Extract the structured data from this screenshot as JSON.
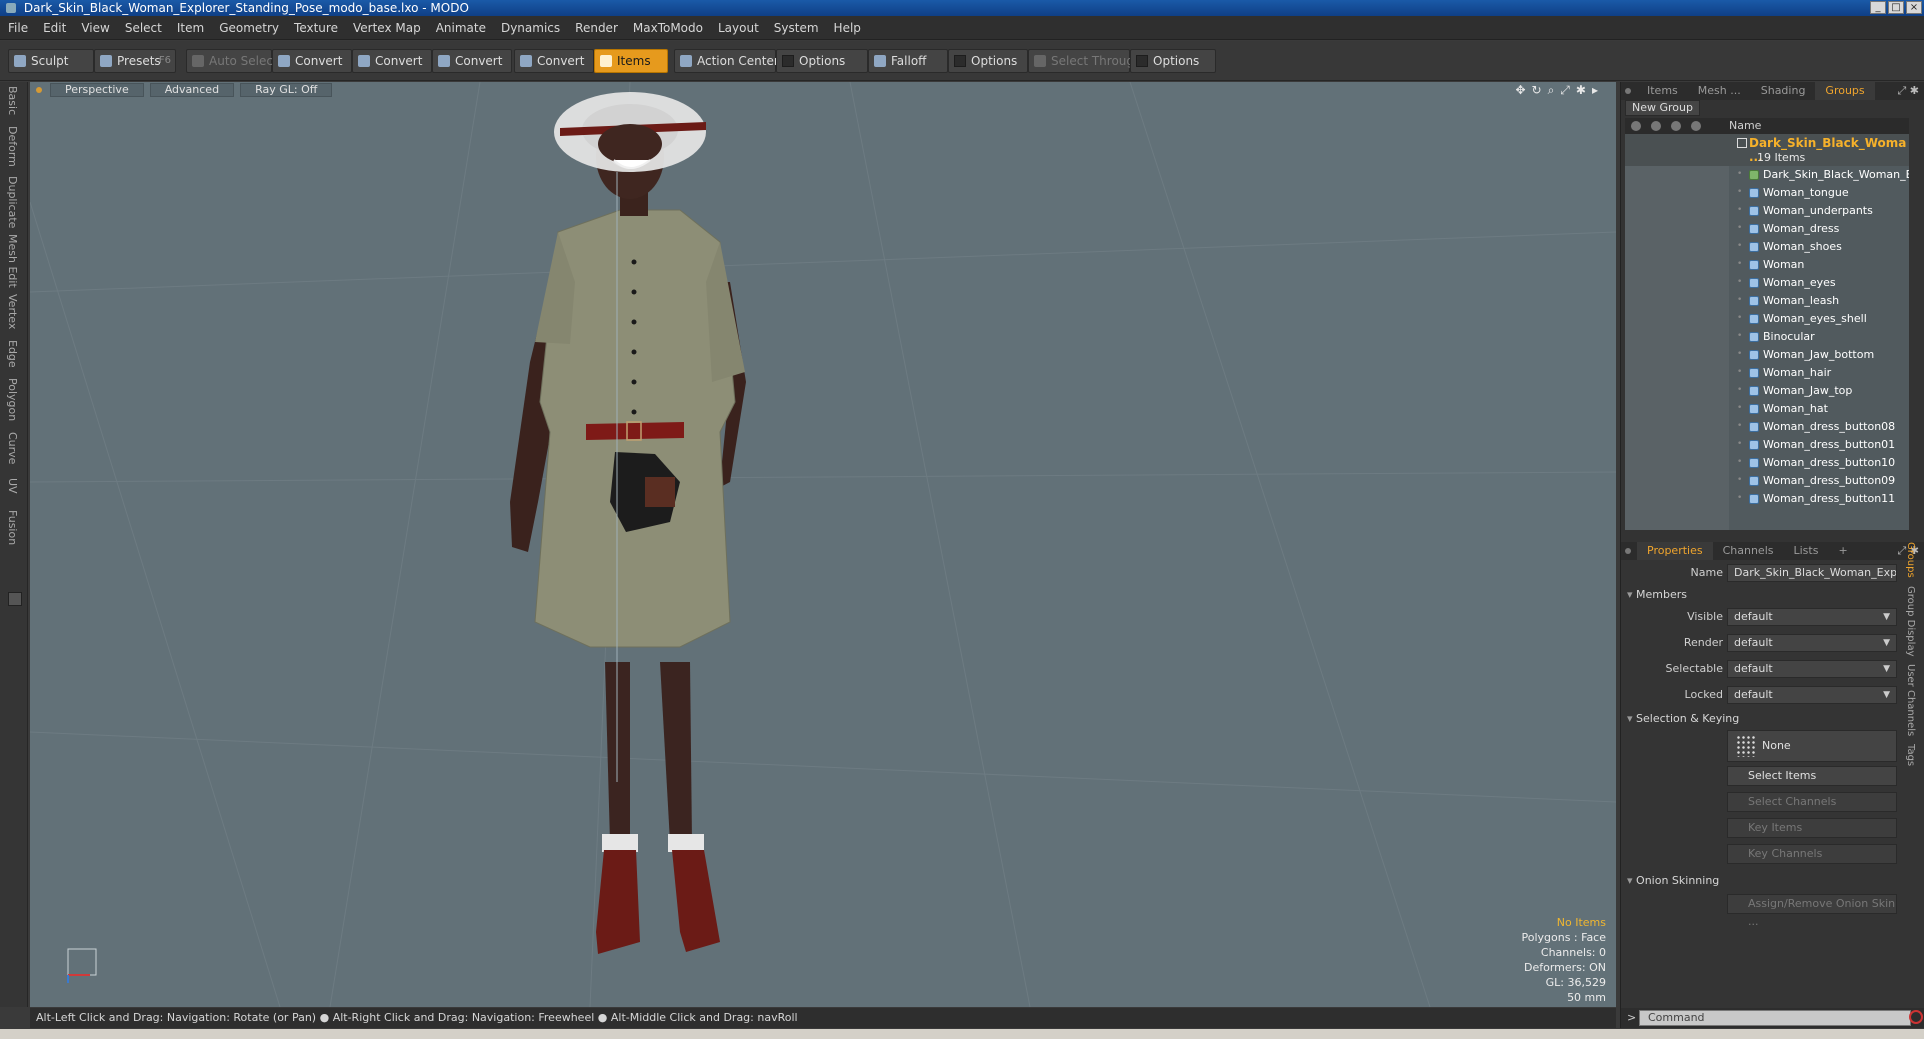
{
  "window": {
    "title": "Dark_Skin_Black_Woman_Explorer_Standing_Pose_modo_base.lxo - MODO",
    "controls": [
      "_",
      "□",
      "×"
    ]
  },
  "menu": [
    "File",
    "Edit",
    "View",
    "Select",
    "Item",
    "Geometry",
    "Texture",
    "Vertex Map",
    "Animate",
    "Dynamics",
    "Render",
    "MaxToModo",
    "Layout",
    "System",
    "Help"
  ],
  "toolbar": {
    "sculpt": "Sculpt",
    "presets": "Presets",
    "presets_hotkey": "F6",
    "auto_select": "Auto Select",
    "convert": "Convert",
    "items": "Items",
    "action_center": "Action Center",
    "options": "Options",
    "falloff": "Falloff",
    "select_through": "Select Through"
  },
  "left_tabs": [
    "Basic",
    "Deform",
    "Duplicate",
    "Mesh Edit",
    "Vertex",
    "Edge",
    "Polygon",
    "Curve",
    "UV",
    "Fusion"
  ],
  "viewport": {
    "view": "Perspective",
    "mode": "Advanced",
    "raygl": "Ray GL: Off",
    "info": {
      "no_items": "No Items",
      "polygons": "Polygons : Face",
      "channels": "Channels: 0",
      "deformers": "Deformers: ON",
      "gl": "GL: 36,529",
      "focal": "50 mm"
    }
  },
  "status": "Alt-Left Click and Drag: Navigation: Rotate (or Pan) ● Alt-Right Click and Drag: Navigation: Freewheel ● Alt-Middle Click and Drag: navRoll",
  "items_panel": {
    "tabs": [
      "Items",
      "Mesh ...",
      "Shading",
      "Groups"
    ],
    "active_tab": "Groups",
    "new_group": "New Group",
    "name_col": "Name",
    "group_name": "Dark_Skin_Black_Woma ...",
    "group_count": "19 Items",
    "rows": [
      "Dark_Skin_Black_Woman_E...",
      "Woman_tongue",
      "Woman_underpants",
      "Woman_dress",
      "Woman_shoes",
      "Woman",
      "Woman_eyes",
      "Woman_leash",
      "Woman_eyes_shell",
      "Binocular",
      "Woman_Jaw_bottom",
      "Woman_hair",
      "Woman_Jaw_top",
      "Woman_hat",
      "Woman_dress_button08",
      "Woman_dress_button01",
      "Woman_dress_button10",
      "Woman_dress_button09",
      "Woman_dress_button11"
    ]
  },
  "properties": {
    "tabs": [
      "Properties",
      "Channels",
      "Lists",
      "+"
    ],
    "name_label": "Name",
    "name_value": "Dark_Skin_Black_Woman_Explor",
    "members": "Members",
    "visible_label": "Visible",
    "render_label": "Render",
    "selectable_label": "Selectable",
    "locked_label": "Locked",
    "default_value": "default",
    "sel_keying": "Selection & Keying",
    "none": "None",
    "select_items": "Select Items",
    "select_channels": "Select Channels",
    "key_items": "Key Items",
    "key_channels": "Key Channels",
    "onion": "Onion Skinning",
    "assign_onion": "Assign/Remove Onion Skin ...",
    "side_tabs": [
      "Groups",
      "Group Display",
      "User Channels",
      "Tags"
    ]
  },
  "command_placeholder": "Command"
}
